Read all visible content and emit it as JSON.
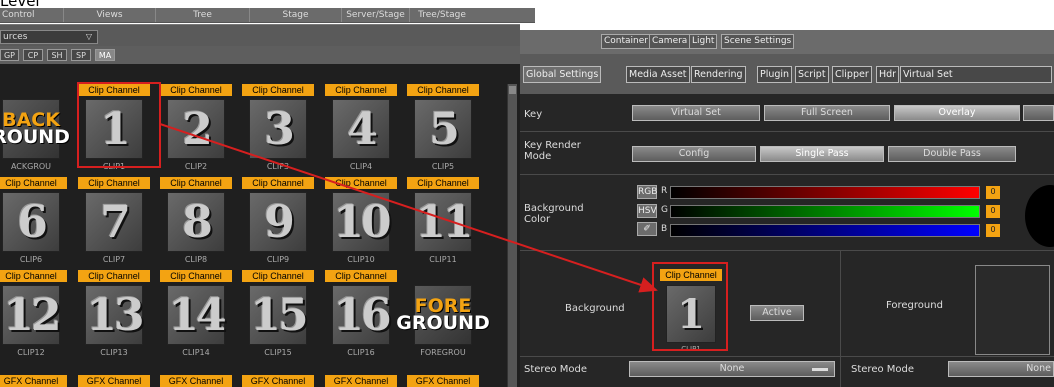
{
  "caption": "Level",
  "menu": [
    "Control",
    "Views",
    "Tree",
    "Stage",
    "Server/Stage",
    "Tree/Stage"
  ],
  "sources": {
    "label": "urces",
    "dropdown_icon": "chevron-down-icon"
  },
  "channel_tabs": [
    "GP",
    "CP",
    "SH",
    "SP",
    "MA"
  ],
  "clip_tag": "Clip Channel",
  "gfx_tag": "GFX Channel",
  "clips": [
    {
      "num": "",
      "name": "ACKGROU",
      "special": "bg"
    },
    {
      "num": "1",
      "name": "CLIP1"
    },
    {
      "num": "2",
      "name": "CLIP2"
    },
    {
      "num": "3",
      "name": "CLIP3"
    },
    {
      "num": "4",
      "name": "CLIP4"
    },
    {
      "num": "5",
      "name": "CLIP5"
    },
    {
      "num": "6",
      "name": "CLIP6"
    },
    {
      "num": "7",
      "name": "CLIP7"
    },
    {
      "num": "8",
      "name": "CLIP8"
    },
    {
      "num": "9",
      "name": "CLIP9"
    },
    {
      "num": "10",
      "name": "CLIP10"
    },
    {
      "num": "11",
      "name": "CLIP11"
    },
    {
      "num": "12",
      "name": "CLIP12"
    },
    {
      "num": "13",
      "name": "CLIP13"
    },
    {
      "num": "14",
      "name": "CLIP14"
    },
    {
      "num": "15",
      "name": "CLIP15"
    },
    {
      "num": "16",
      "name": "CLIP16"
    },
    {
      "num": "",
      "name": "FOREGROU",
      "special": "fg"
    }
  ],
  "bg_word": {
    "l1": "BACK",
    "l2": "ROUND"
  },
  "fg_word": {
    "l1": "FORE",
    "l2": "GROUND"
  },
  "top_tabs": [
    "Container",
    "Camera",
    "Light",
    "Scene Settings"
  ],
  "global_tabs": [
    "Global Settings",
    "Media Asset",
    "Rendering",
    "Plugin",
    "Script",
    "Clipper",
    "Hdr",
    "Virtual Set"
  ],
  "key": {
    "label": "Key",
    "options": [
      "Virtual Set",
      "Full Screen",
      "Overlay"
    ],
    "selected": "Overlay"
  },
  "key_render": {
    "label1": "Key Render",
    "label2": "Mode",
    "options": [
      "Config",
      "Single Pass",
      "Double Pass"
    ],
    "selected": "Single Pass"
  },
  "bg_color": {
    "label1": "Background",
    "label2": "Color",
    "rgb": "RGB",
    "hsv": "HSV",
    "picker_icon": "eyedropper-icon",
    "channels": [
      "R",
      "G",
      "B"
    ],
    "values": [
      "0",
      "0",
      "0"
    ],
    "colors": [
      "#ff0000",
      "#00ff00",
      "#0000ff"
    ]
  },
  "background": {
    "label": "Background",
    "clip_tag": "Clip Channel",
    "clip_num": "1",
    "clip_name": "CLIP1",
    "active": "Active"
  },
  "foreground": {
    "label": "Foreground"
  },
  "stereo": {
    "label": "Stereo Mode",
    "value": "None",
    "label2": "Stereo Mode",
    "value2": "None"
  }
}
